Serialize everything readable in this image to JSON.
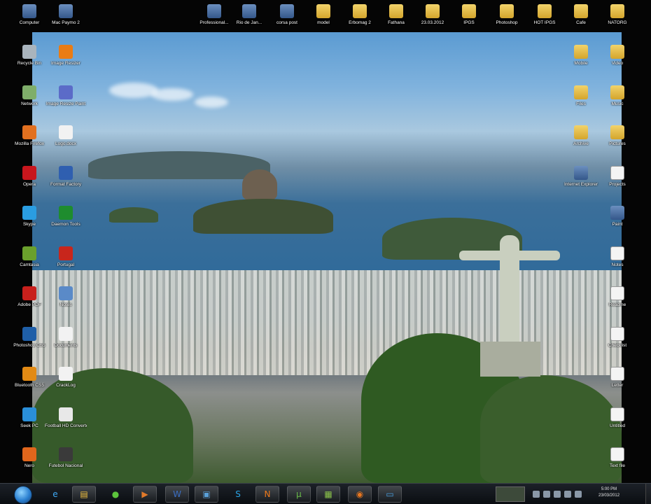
{
  "desktop": {
    "top_row": [
      {
        "label": "Computer",
        "icon": "computer-icon",
        "type": "exe"
      },
      {
        "label": "Mac Paymo 2",
        "icon": "mac-icon",
        "type": "exe"
      },
      {
        "label": "Professional...",
        "icon": "flag-icon",
        "type": "exe"
      },
      {
        "label": "Rio de Jan...",
        "icon": "image-icon",
        "type": "exe"
      },
      {
        "label": "corsa post",
        "icon": "blue-app-icon",
        "type": "exe"
      },
      {
        "label": "model",
        "icon": "folder-icon",
        "type": "folder"
      },
      {
        "label": "Erbomag 2",
        "icon": "folder-icon",
        "type": "folder"
      },
      {
        "label": "Fathana",
        "icon": "folder-icon",
        "type": "folder"
      },
      {
        "label": "23.03.2012",
        "icon": "folder-icon",
        "type": "folder"
      },
      {
        "label": "IPGS",
        "icon": "folder-icon",
        "type": "folder"
      },
      {
        "label": "Photoshop",
        "icon": "folder-icon",
        "type": "folder"
      },
      {
        "label": "HOT IPGS",
        "icon": "folder-icon",
        "type": "folder"
      },
      {
        "label": "Cafe",
        "icon": "folder-icon",
        "type": "folder"
      },
      {
        "label": "NATORG",
        "icon": "folder-icon",
        "type": "folder"
      }
    ],
    "left_col1": [
      {
        "label": "Recycle Bin",
        "icon": "recycle-bin-icon",
        "color": "#a9b4bd"
      },
      {
        "label": "Network",
        "icon": "network-icon",
        "color": "#7fae6a"
      },
      {
        "label": "Mozilla Firefox",
        "icon": "firefox-icon",
        "color": "#e2701f"
      },
      {
        "label": "Opera",
        "icon": "opera-icon",
        "color": "#c8161d"
      },
      {
        "label": "Skype",
        "icon": "skype-icon",
        "color": "#2a9de2"
      },
      {
        "label": "Camtasia",
        "icon": "camtasia-icon",
        "color": "#6aa02c"
      },
      {
        "label": "Adobe PDF",
        "icon": "pdf-icon",
        "color": "#c8201c"
      },
      {
        "label": "Photoshop CS5",
        "icon": "photoshop-icon",
        "color": "#1f5fa8"
      },
      {
        "label": "Bluetooth CS5",
        "icon": "illustrator-icon",
        "color": "#e28a14"
      },
      {
        "label": "Seek PC",
        "icon": "globe-icon",
        "color": "#2a8fd9"
      },
      {
        "label": "Nero",
        "icon": "nero-icon",
        "color": "#e0661c"
      }
    ],
    "left_col2": [
      {
        "label": "Image Resizer",
        "icon": "vlc-icon",
        "color": "#ea7c14"
      },
      {
        "label": "Image Resize Paint",
        "icon": "paint-icon",
        "color": "#5b6bc8"
      },
      {
        "label": "Logo.docx",
        "icon": "document-icon",
        "color": "#f2f2f2"
      },
      {
        "label": "Format Factory",
        "icon": "media-icon",
        "color": "#2f5fb0"
      },
      {
        "label": "Daemon Tools",
        "icon": "play-icon",
        "color": "#1e8c2e"
      },
      {
        "label": "Portugal",
        "icon": "flag-icon",
        "color": "#c8261c"
      },
      {
        "label": "Notes",
        "icon": "notes-icon",
        "color": "#5a8ac8"
      },
      {
        "label": "Documents",
        "icon": "document-icon",
        "color": "#f2f2f2"
      },
      {
        "label": "CrackLog",
        "icon": "document-icon",
        "color": "#f2f2f2"
      },
      {
        "label": "Football HD Converter",
        "icon": "football-icon",
        "color": "#e8e8e8"
      },
      {
        "label": "Futebol Nacional",
        "icon": "video-icon",
        "color": "#3a3a3a"
      }
    ],
    "right_col1": [
      {
        "label": "Mobile",
        "icon": "folder-icon",
        "type": "folder"
      },
      {
        "label": "Files",
        "icon": "folder-icon",
        "type": "folder"
      },
      {
        "label": "Archive",
        "icon": "folder-icon",
        "type": "folder"
      },
      {
        "label": "Internet Explorer",
        "icon": "internet-explorer-icon",
        "type": "exe"
      }
    ],
    "right_col2": [
      {
        "label": "Video",
        "icon": "folder-icon",
        "type": "folder"
      },
      {
        "label": "Music",
        "icon": "folder-icon",
        "type": "folder"
      },
      {
        "label": "Pictures",
        "icon": "folder-icon",
        "type": "folder"
      },
      {
        "label": "Projects",
        "icon": "document-icon",
        "type": "doc"
      },
      {
        "label": "Paint",
        "icon": "paint-icon",
        "type": "exe"
      },
      {
        "label": "Notes",
        "icon": "document-icon",
        "type": "doc"
      },
      {
        "label": "Readme",
        "icon": "document-icon",
        "type": "doc"
      },
      {
        "label": "Checklist",
        "icon": "document-icon",
        "type": "doc"
      },
      {
        "label": "Letter",
        "icon": "document-icon",
        "type": "doc"
      },
      {
        "label": "Untitled",
        "icon": "document-icon",
        "type": "doc"
      },
      {
        "label": "Text file",
        "icon": "document-icon",
        "type": "doc"
      }
    ]
  },
  "taskbar": {
    "pinned": [
      {
        "name": "internet-explorer-icon",
        "glyph": "e",
        "color": "#3fa9f5"
      },
      {
        "name": "windows-explorer-icon",
        "glyph": "▤",
        "color": "#f0c040"
      },
      {
        "name": "media-player-icon",
        "glyph": "●",
        "color": "#5cc43c"
      },
      {
        "name": "video-player-icon",
        "glyph": "▶",
        "color": "#e27a2a"
      },
      {
        "name": "word-icon",
        "glyph": "W",
        "color": "#3b6fc4"
      },
      {
        "name": "image-viewer-icon",
        "glyph": "▣",
        "color": "#5aa0d8"
      },
      {
        "name": "skype-icon",
        "glyph": "S",
        "color": "#2aa6e8"
      },
      {
        "name": "nero-icon",
        "glyph": "N",
        "color": "#f07a1a"
      },
      {
        "name": "utorrent-icon",
        "glyph": "µ",
        "color": "#6cc04a"
      },
      {
        "name": "camtasia-icon",
        "glyph": "▦",
        "color": "#8ac24a"
      },
      {
        "name": "firefox-icon",
        "glyph": "◉",
        "color": "#e8761e"
      },
      {
        "name": "screen-recorder-icon",
        "glyph": "▭",
        "color": "#4aa0e0"
      }
    ],
    "clock_time": "5:00 PM",
    "clock_date": "23/03/2012"
  }
}
